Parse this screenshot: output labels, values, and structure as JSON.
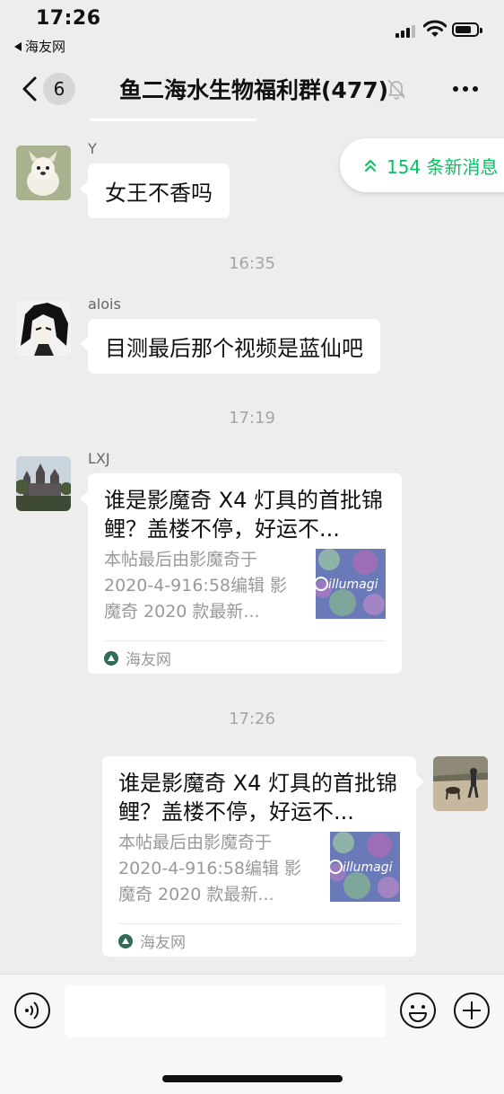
{
  "status_bar": {
    "time": "17:26",
    "back_app_label": "海友网"
  },
  "nav": {
    "unread_count": "6",
    "title": "鱼二海水生物福利群(477)",
    "muted": true
  },
  "new_messages": {
    "label": "154 条新消息"
  },
  "messages": [
    {
      "sender": "Y",
      "text": "女王不香吗"
    },
    {
      "timestamp": "16:35"
    },
    {
      "sender": "alois",
      "text": "目测最后那个视频是蓝仙吧"
    },
    {
      "timestamp": "17:19"
    },
    {
      "sender": "LXJ",
      "card": {
        "title": "谁是影魔奇 X4 灯具的首批锦鲤？盖楼不停，好运不...",
        "description": "本帖最后由影魔奇于2020-4-916:58编辑 影魔奇 2020 款最新...",
        "source": "海友网",
        "thumbnail_text": "illumagi"
      }
    },
    {
      "timestamp": "17:26"
    },
    {
      "sender": "me",
      "card": {
        "title": "谁是影魔奇 X4 灯具的首批锦鲤？盖楼不停，好运不...",
        "description": "本帖最后由影魔奇于2020-4-916:58编辑 影魔奇 2020 款最新...",
        "source": "海友网",
        "thumbnail_text": "illumagi"
      }
    }
  ],
  "input_bar": {
    "value": ""
  },
  "colors": {
    "accent_green": "#07c160",
    "background": "#ededed"
  }
}
